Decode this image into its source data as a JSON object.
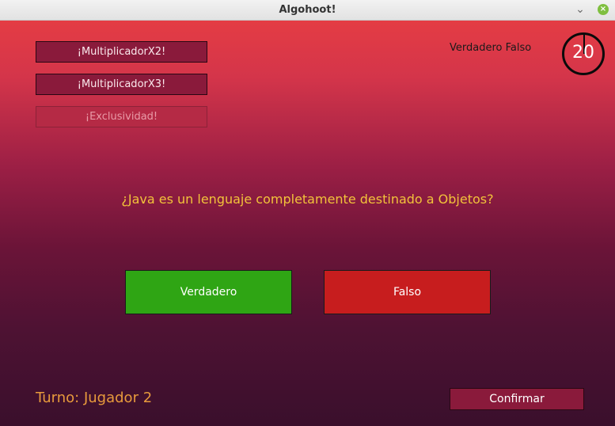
{
  "window": {
    "title": "Algohoot!",
    "minimize_glyph": "⌄",
    "close_glyph": "×"
  },
  "powers": [
    {
      "label": "¡MultiplicadorX2!",
      "enabled": true
    },
    {
      "label": "¡MultiplicadorX3!",
      "enabled": true
    },
    {
      "label": "¡Exclusividad!",
      "enabled": false
    }
  ],
  "question_type": "Verdadero Falso",
  "timer": {
    "seconds": "20"
  },
  "question": "¿Java es un lenguaje completamente destinado a Objetos?",
  "answers": {
    "true_label": "Verdadero",
    "false_label": "Falso"
  },
  "turn": "Turno: Jugador 2",
  "confirm_label": "Confirmar",
  "colors": {
    "accent_button": "#8a1a3b",
    "true_button": "#2fa514",
    "false_button": "#c71d1e",
    "question_text": "#f2c23a",
    "turn_text": "#e79a3c"
  }
}
